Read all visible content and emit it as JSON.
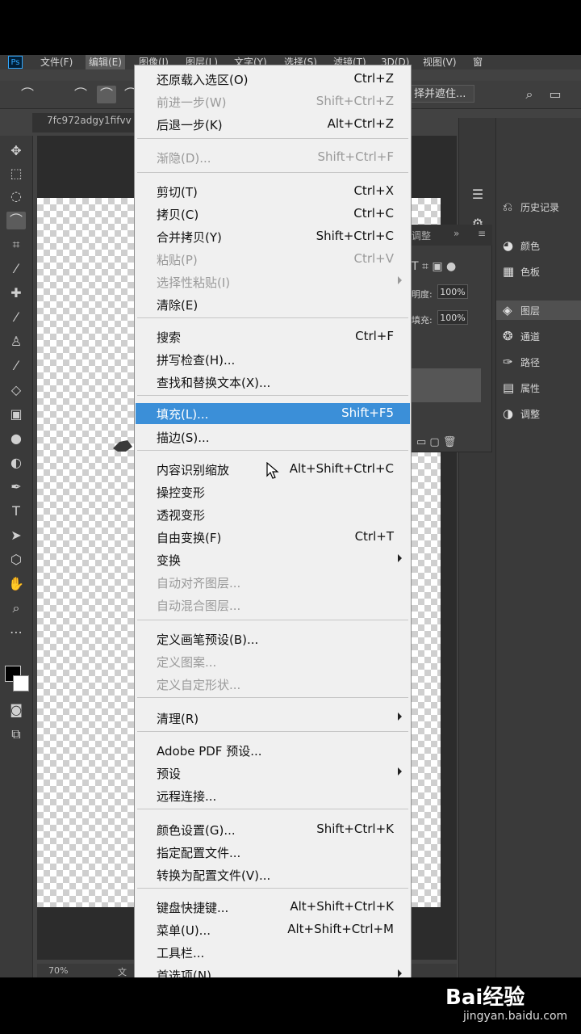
{
  "menubar": {
    "ps_logo": "Ps",
    "file": "文件(F)",
    "edit": "编辑(E)",
    "image": "图像(I)",
    "layer": "图层(L)",
    "type": "文字(Y)",
    "select": "选择(S)",
    "filter": "滤镜(T)",
    "threed": "3D(D)",
    "view": "视图(V)",
    "window": "窗"
  },
  "options": {
    "select_subject": "择并遮住..."
  },
  "document": {
    "tab_title": "7fc972adgy1fifvv",
    "zoom": "70%",
    "status_partial": "文"
  },
  "panels": {
    "history": "历史记录",
    "color": "颜色",
    "swatches": "色板",
    "layers": "图层",
    "channels": "通道",
    "paths": "路径",
    "properties": "属性",
    "adjustments": "调整"
  },
  "layers_panel": {
    "adjust_tab": "调整",
    "opacity_label": "明度:",
    "opacity_value": "100%",
    "fill_label": "填充:",
    "fill_value": "100%"
  },
  "edit_menu": {
    "undo": {
      "label": "还原载入选区(O)",
      "shortcut": "Ctrl+Z"
    },
    "step_forward": {
      "label": "前进一步(W)",
      "shortcut": "Shift+Ctrl+Z"
    },
    "step_backward": {
      "label": "后退一步(K)",
      "shortcut": "Alt+Ctrl+Z"
    },
    "fade": {
      "label": "渐隐(D)...",
      "shortcut": "Shift+Ctrl+F"
    },
    "cut": {
      "label": "剪切(T)",
      "shortcut": "Ctrl+X"
    },
    "copy": {
      "label": "拷贝(C)",
      "shortcut": "Ctrl+C"
    },
    "copy_merged": {
      "label": "合并拷贝(Y)",
      "shortcut": "Shift+Ctrl+C"
    },
    "paste": {
      "label": "粘贴(P)",
      "shortcut": "Ctrl+V"
    },
    "paste_special": {
      "label": "选择性粘贴(I)"
    },
    "clear": {
      "label": "清除(E)"
    },
    "search": {
      "label": "搜索",
      "shortcut": "Ctrl+F"
    },
    "spell_check": {
      "label": "拼写检查(H)..."
    },
    "find_replace": {
      "label": "查找和替换文本(X)..."
    },
    "fill": {
      "label": "填充(L)...",
      "shortcut": "Shift+F5"
    },
    "stroke": {
      "label": "描边(S)..."
    },
    "content_aware_scale": {
      "label": "内容识别缩放",
      "shortcut": "Alt+Shift+Ctrl+C"
    },
    "puppet_warp": {
      "label": "操控变形"
    },
    "perspective_warp": {
      "label": "透视变形"
    },
    "free_transform": {
      "label": "自由变换(F)",
      "shortcut": "Ctrl+T"
    },
    "transform": {
      "label": "变换"
    },
    "auto_align": {
      "label": "自动对齐图层..."
    },
    "auto_blend": {
      "label": "自动混合图层..."
    },
    "define_brush": {
      "label": "定义画笔预设(B)..."
    },
    "define_pattern": {
      "label": "定义图案..."
    },
    "define_shape": {
      "label": "定义自定形状..."
    },
    "purge": {
      "label": "清理(R)"
    },
    "pdf_presets": {
      "label": "Adobe PDF 预设..."
    },
    "presets": {
      "label": "预设"
    },
    "remote": {
      "label": "远程连接..."
    },
    "color_settings": {
      "label": "颜色设置(G)...",
      "shortcut": "Shift+Ctrl+K"
    },
    "assign_profile": {
      "label": "指定配置文件..."
    },
    "convert_profile": {
      "label": "转换为配置文件(V)..."
    },
    "keyboard_shortcuts": {
      "label": "键盘快捷键...",
      "shortcut": "Alt+Shift+Ctrl+K"
    },
    "menus": {
      "label": "菜单(U)...",
      "shortcut": "Alt+Shift+Ctrl+M"
    },
    "toolbar": {
      "label": "工具栏..."
    },
    "preferences": {
      "label": "首选项(N)"
    }
  },
  "watermark": {
    "logo": "Bai经验",
    "url": "jingyan.baidu.com"
  },
  "colors": {
    "menu_bg": "#f0f0f0",
    "highlight": "#3b8fd8",
    "app_bg": "#424242"
  }
}
